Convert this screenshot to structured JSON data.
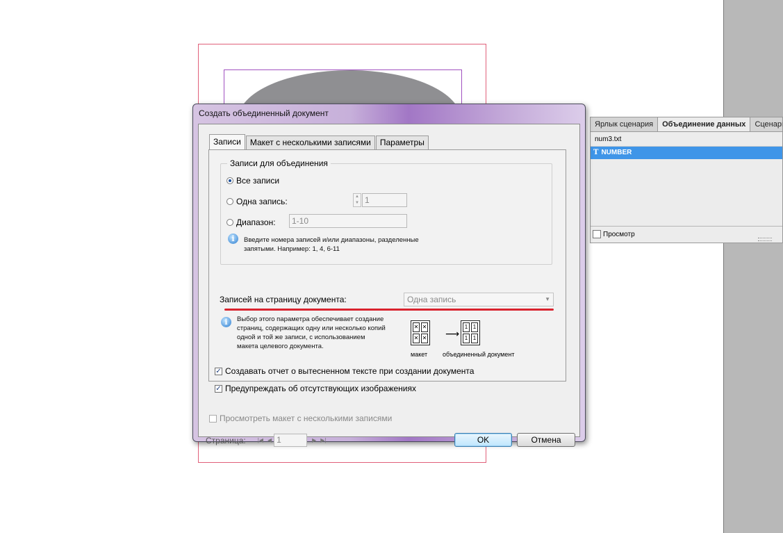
{
  "panel": {
    "tabs": [
      "Ярлык сценария",
      "Объединение данных",
      "Сценарии"
    ],
    "source_file": "num3.txt",
    "field_icon": "T",
    "field": "NUMBER",
    "preview_label": "Просмотр"
  },
  "dialog": {
    "title": "Создать объединенный документ",
    "tabs": [
      "Записи",
      "Макет с несколькими записями",
      "Параметры"
    ],
    "group_title": "Записи для объединения",
    "all_records": "Все записи",
    "one_record": "Одна запись:",
    "one_record_value": "1",
    "range": "Диапазон:",
    "range_value": "1-10",
    "range_hint": [
      "Введите номера записей и/или диапазоны, разделенные",
      "запятыми. Например: 1, 4, 6-11"
    ],
    "per_page_label": "Записей на страницу документа:",
    "per_page_value": "Одна запись",
    "per_page_hint": [
      "Выбор этого параметра обеспечивает создание",
      "страниц, содержащих одну или несколько копий",
      "одной и той же записи, с использованием",
      "макета целевого документа."
    ],
    "diagram_left_caption": "макет",
    "diagram_right_caption": "объединенный документ",
    "overset_report": "Создавать отчет о вытесненном тексте при создании документа",
    "missing_images": "Предупреждать об отсутствующих изображениях",
    "preview_multi": "Просмотреть макет с несколькими записями",
    "page_label": "Страница:",
    "page_value": "1",
    "ok": "OK",
    "cancel": "Отмена"
  },
  "colors": {
    "accent_red": "#d9232e",
    "selection_blue": "#3f95e8"
  },
  "icons": [
    "info-icon",
    "radio-icon",
    "checkbox-icon",
    "first-page-icon",
    "prev-page-icon",
    "next-page-icon",
    "last-page-icon",
    "text-field-icon"
  ]
}
